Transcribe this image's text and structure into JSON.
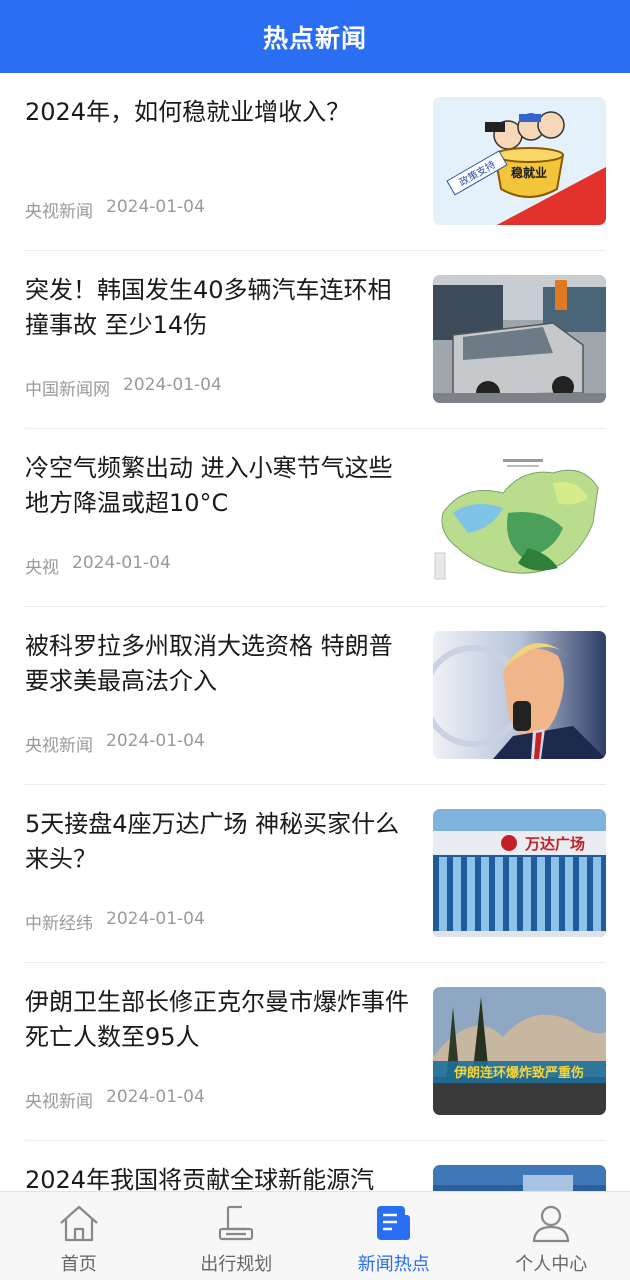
{
  "header": {
    "title": "热点新闻"
  },
  "news": [
    {
      "title": "2024年，如何稳就业增收入？",
      "source": "央视新闻",
      "date": "2024-01-04",
      "image_text": [
        "稳就业",
        "政策支持"
      ]
    },
    {
      "title": "突发！韩国发生40多辆汽车连环相撞事故 至少14伤",
      "source": "中国新闻网",
      "date": "2024-01-04"
    },
    {
      "title": "冷空气频繁出动 进入小寒节气这些地方降温或超10°C",
      "source": "央视",
      "date": "2024-01-04"
    },
    {
      "title": "被科罗拉多州取消大选资格 特朗普要求美最高法介入",
      "source": "央视新闻",
      "date": "2024-01-04"
    },
    {
      "title": "5天接盘4座万达广场 神秘买家什么来头？",
      "source": "中新经纬",
      "date": "2024-01-04",
      "image_text": [
        "万达广场"
      ]
    },
    {
      "title": "伊朗卫生部长修正克尔曼市爆炸事件死亡人数至95人",
      "source": "央视新闻",
      "date": "2024-01-04",
      "image_text": [
        "伊朗连环爆炸致严重伤"
      ]
    },
    {
      "title": "2024年我国将贡献全球新能源汽",
      "source": "",
      "date": ""
    }
  ],
  "tabbar": {
    "active_color": "#2a6ef3",
    "items": [
      {
        "label": "首页",
        "icon": "home-icon",
        "active": false
      },
      {
        "label": "出行规划",
        "icon": "route-plan-icon",
        "active": false
      },
      {
        "label": "新闻热点",
        "icon": "news-icon",
        "active": true
      },
      {
        "label": "个人中心",
        "icon": "user-icon",
        "active": false
      }
    ]
  }
}
